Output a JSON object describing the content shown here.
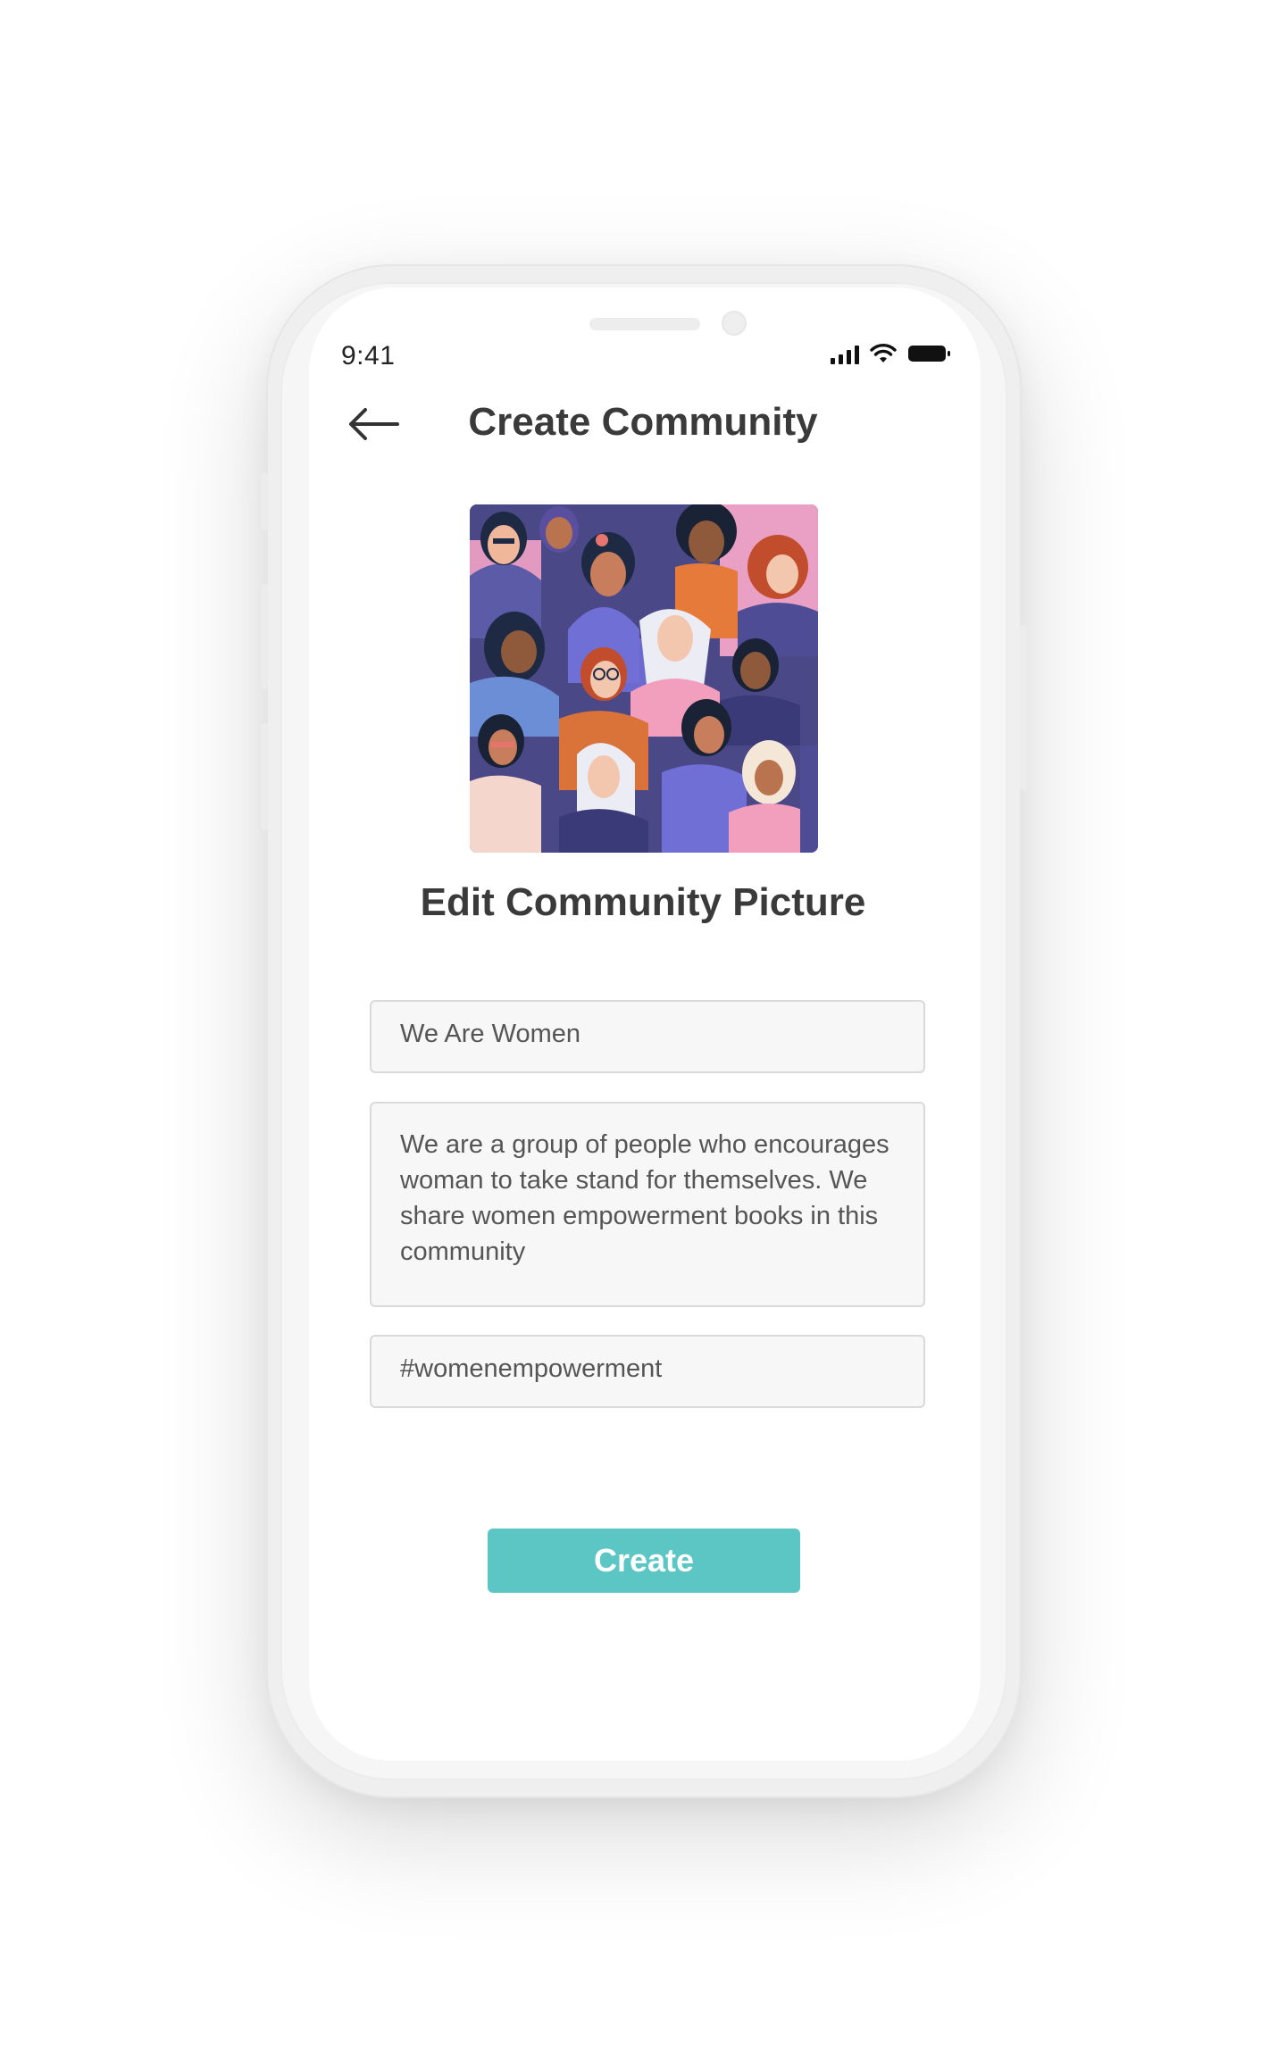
{
  "status_bar": {
    "time": "9:41",
    "icons": [
      "signal-icon",
      "wifi-icon",
      "battery-icon"
    ]
  },
  "header": {
    "back_icon": "arrow-left-icon",
    "title": "Create Community"
  },
  "community_picture": {
    "image": "illustration of diverse women group",
    "edit_label": "Edit Community Picture"
  },
  "form": {
    "name_value": "We Are Women",
    "description_value": "We are a group of people who encourages woman to take stand for themselves. We share women empowerment books in this community",
    "tags_value": "#womenempowerment"
  },
  "actions": {
    "create_label": "Create"
  },
  "colors": {
    "accent": "#5cc6c4",
    "title_text": "#3a3a3a",
    "field_bg": "#f7f7f7",
    "field_border": "#dadada"
  }
}
